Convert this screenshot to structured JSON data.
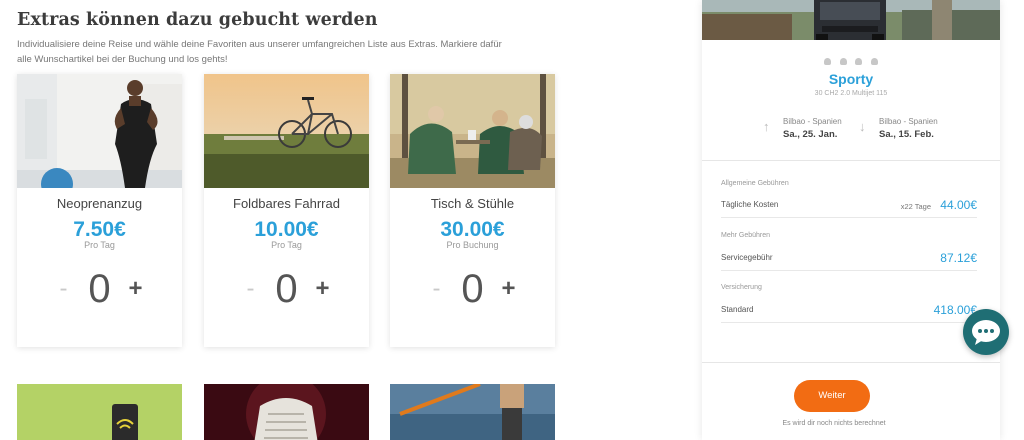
{
  "page": {
    "title": "Extras können dazu gebucht werden",
    "intro": "Individualisiere deine Reise und wähle deine Favoriten aus unserer umfangreichen Liste aus Extras. Markiere dafür alle Wunschartikel bei der Buchung und los gehts!"
  },
  "extras": [
    {
      "name": "Neoprenanzug",
      "price": "7.50€",
      "unit": "Pro Tag",
      "qty": "0",
      "minus": "-",
      "plus": "+"
    },
    {
      "name": "Foldbares Fahrrad",
      "price": "10.00€",
      "unit": "Pro Tag",
      "qty": "0",
      "minus": "-",
      "plus": "+"
    },
    {
      "name": "Tisch & Stühle",
      "price": "30.00€",
      "unit": "Pro Buchung",
      "qty": "0",
      "minus": "-",
      "plus": "+"
    }
  ],
  "summary": {
    "vehicle_name": "Sporty",
    "vehicle_sub": "30 CH2 2.0 Multijet 115",
    "pickup": {
      "location": "Bilbao - Spanien",
      "date": "Sa., 25. Jan."
    },
    "dropoff": {
      "location": "Bilbao - Spanien",
      "date": "Sa., 15. Feb."
    },
    "general_fees_title": "Allgemeine Gebühren",
    "daily_label": "Tägliche Kosten",
    "daily_mult": "x22 Tage",
    "daily_value": "44.00€",
    "more_fees_title": "Mehr Gebühren",
    "service_label": "Servicegebühr",
    "service_value": "87.12€",
    "insurance_title": "Versicherung",
    "insurance_label": "Standard",
    "insurance_value": "418.00€",
    "continue_label": "Weiter",
    "note": "Es wird dir noch nichts berechnet"
  },
  "colors": {
    "accent": "#2ba0d9",
    "button": "#f26c13",
    "chat": "#1f6e74"
  },
  "icons": [
    "arrow-up-icon",
    "arrow-down-icon",
    "person-icon",
    "chat-bubble-icon"
  ]
}
